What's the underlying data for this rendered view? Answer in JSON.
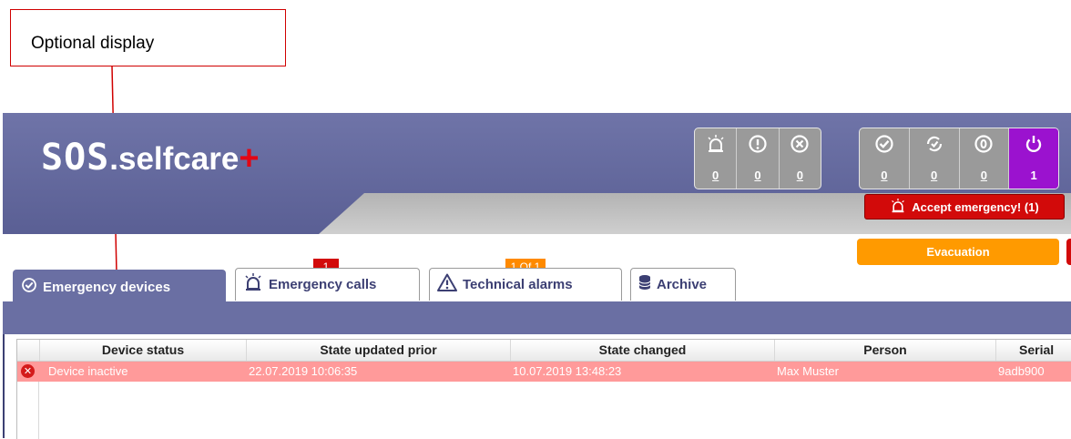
{
  "callout": {
    "label": "Optional display"
  },
  "header": {
    "logo": {
      "sos": "SOS",
      "selfcare": ".selfcare",
      "plus": "+"
    },
    "counters_left": [
      {
        "icon": "alarm-siren-icon",
        "glyph": "🚨",
        "value": "0"
      },
      {
        "icon": "exclamation-circle-icon",
        "glyph": "ⓘ",
        "value": "0"
      },
      {
        "icon": "x-circle-icon",
        "glyph": "⊗",
        "value": "0"
      }
    ],
    "counters_right": [
      {
        "icon": "check-circle-icon",
        "glyph": "✔",
        "value": "0"
      },
      {
        "icon": "sync-check-icon",
        "glyph": "↻",
        "value": "0"
      },
      {
        "icon": "pause-circle-icon",
        "glyph": "⓪",
        "value": "0"
      },
      {
        "icon": "power-icon",
        "glyph": "⏻",
        "value": "1",
        "active": true
      }
    ],
    "accept_button": "Accept emergency! (1)",
    "evacuation_button": "Evacuation"
  },
  "tabs": [
    {
      "label": "Emergency devices",
      "icon": "check-circle-icon",
      "active": true
    },
    {
      "label": "Emergency calls",
      "icon": "alarm-siren-icon",
      "badge": "1"
    },
    {
      "label": "Technical alarms",
      "icon": "warning-triangle-icon",
      "badge": "1 Of 1"
    },
    {
      "label": "Archive",
      "icon": "database-icon"
    }
  ],
  "table": {
    "columns": [
      "Device status",
      "State updated prior",
      "State changed",
      "Person",
      "Serial"
    ],
    "rows": [
      [
        "Device inactive",
        "22.07.2019 10:06:35",
        "10.07.2019 13:48:23",
        "Max Muster",
        "9adb900"
      ]
    ]
  },
  "colors": {
    "header_bg": "#6a6fa3",
    "accent_red": "#d20a0a",
    "accent_orange": "#ff9a00",
    "active_purple": "#9b12cf",
    "row_error": "#ff9a9a"
  }
}
